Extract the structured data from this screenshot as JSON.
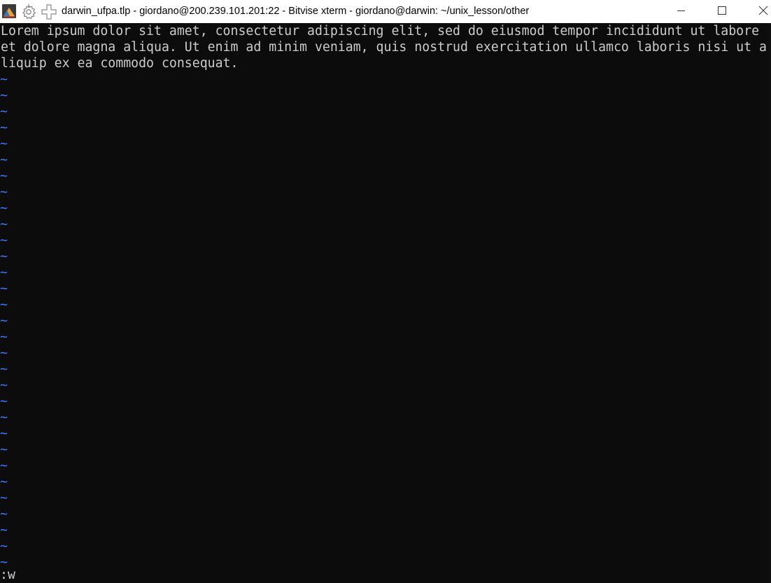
{
  "window": {
    "title": "darwin_ufpa.tlp - giordano@200.239.101.201:22 - Bitvise xterm - giordano@darwin: ~/unix_lesson/other",
    "app_icon": "bitvise-app-icon",
    "settings_icon": "gear-icon",
    "new_window_icon": "new-terminal-icon",
    "buttons": [
      "minimize-icon",
      "maximize-icon",
      "close-icon"
    ]
  },
  "terminal": {
    "lines": [
      "Lorem ipsum dolor sit amet, consectetur adipiscing elit, sed do eiusmod tempor incididunt ut labore",
      "et dolore magna aliqua. Ut enim ad minim veniam, quis nostrud exercitation ullamco laboris nisi ut a",
      "liquip ex ea commodo consequat."
    ],
    "empty_line_marker": "~",
    "command_line": ":w",
    "colors": {
      "background": "#0c0c0c",
      "text": "#cccccc",
      "tilde": "#3b78ff"
    }
  }
}
